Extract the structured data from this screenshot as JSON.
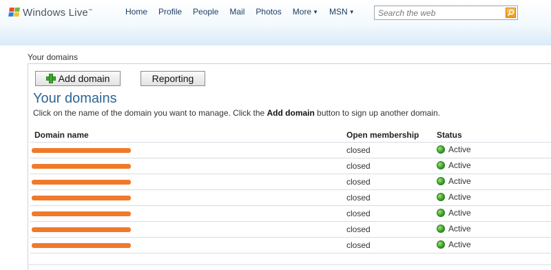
{
  "header": {
    "logo_text": "Windows Live",
    "logo_tm": "™",
    "nav": [
      "Home",
      "Profile",
      "People",
      "Mail",
      "Photos"
    ],
    "more_label": "More",
    "msn_label": "MSN",
    "search_placeholder": "Search the web"
  },
  "breadcrumb": "Your domains",
  "toolbar": {
    "add_domain_label": "Add domain",
    "reporting_label": "Reporting"
  },
  "page": {
    "title": "Your domains",
    "instructions_pre": "Click on the name of the domain you want to manage. Click the ",
    "instructions_bold": "Add domain",
    "instructions_post": " button to sign up another domain."
  },
  "table": {
    "headers": [
      "Domain name",
      "Open membership",
      "Status"
    ],
    "rows": [
      {
        "open": "closed",
        "status": "Active"
      },
      {
        "open": "closed",
        "status": "Active"
      },
      {
        "open": "closed",
        "status": "Active"
      },
      {
        "open": "closed",
        "status": "Active"
      },
      {
        "open": "closed",
        "status": "Active"
      },
      {
        "open": "closed",
        "status": "Active"
      },
      {
        "open": "closed",
        "status": "Active"
      }
    ]
  },
  "colors": {
    "title_blue": "#2f6593",
    "redaction_orange": "#f07a2a",
    "status_green": "#3da52a"
  }
}
